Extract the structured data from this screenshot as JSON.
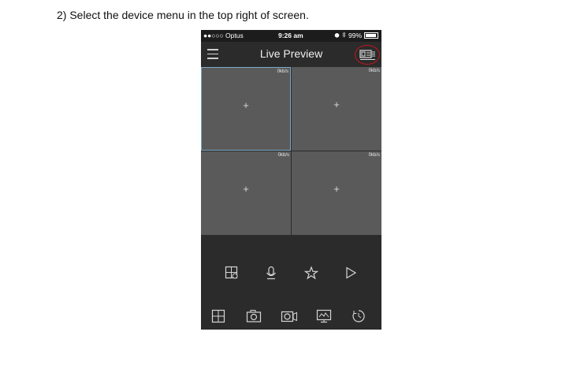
{
  "instruction": {
    "text": "2)  Select the device menu in the top right of screen."
  },
  "status_bar": {
    "carrier": "●●○○○ Optus",
    "time": "9:26 am",
    "battery": "99%"
  },
  "nav": {
    "title": "Live Preview"
  },
  "channels": [
    {
      "rate": "0kb/s",
      "selected": true
    },
    {
      "rate": "0kb/s",
      "selected": false
    },
    {
      "rate": "0kb/s",
      "selected": false
    },
    {
      "rate": "0kb/s",
      "selected": false
    }
  ],
  "plus_symbol": "+",
  "icons": {
    "top_controls": [
      "layout-playback-icon",
      "microphone-icon",
      "star-icon",
      "play-icon"
    ],
    "bottom_controls": [
      "grid-layout-icon",
      "snapshot-camera-icon",
      "record-video-icon",
      "display-monitor-icon",
      "playback-timer-icon"
    ]
  },
  "colors": {
    "highlight_circle": "#c4161c",
    "selected_border": "#7aa9c7"
  }
}
